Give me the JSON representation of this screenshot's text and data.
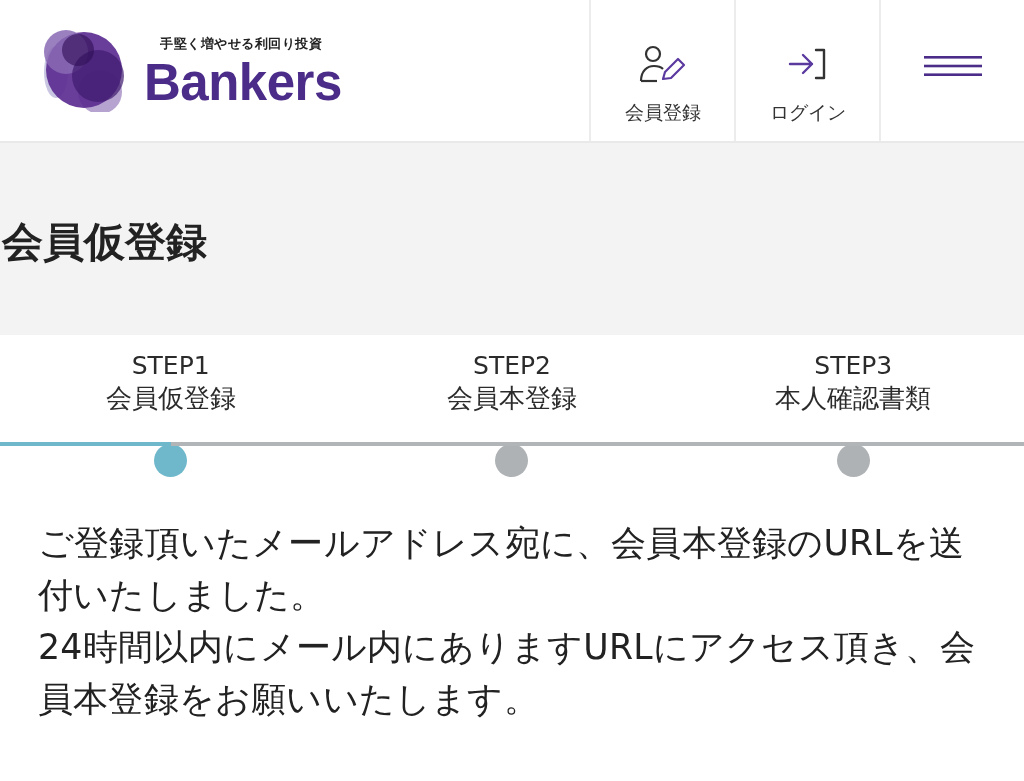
{
  "header": {
    "logo": {
      "tagline": "手堅く増やせる利回り投資",
      "name": "Bankers"
    },
    "nav": [
      {
        "kind": "register",
        "label": "会員登録"
      },
      {
        "kind": "login",
        "label": "ログイン"
      }
    ]
  },
  "page_title": "会員仮登録",
  "steps": [
    {
      "step": "STEP1",
      "label": "会員仮登録",
      "selected": true
    },
    {
      "step": "STEP2",
      "label": "会員本登録",
      "selected": false
    },
    {
      "step": "STEP3",
      "label": "本人確認書類",
      "selected": false
    }
  ],
  "message": [
    "ご登録頂いたメールアドレス宛に、会員本登録のURLを送付いたしました。",
    "24時間以内にメール内にありますURLにアクセス頂き、会員本登録をお願いいたします。"
  ]
}
